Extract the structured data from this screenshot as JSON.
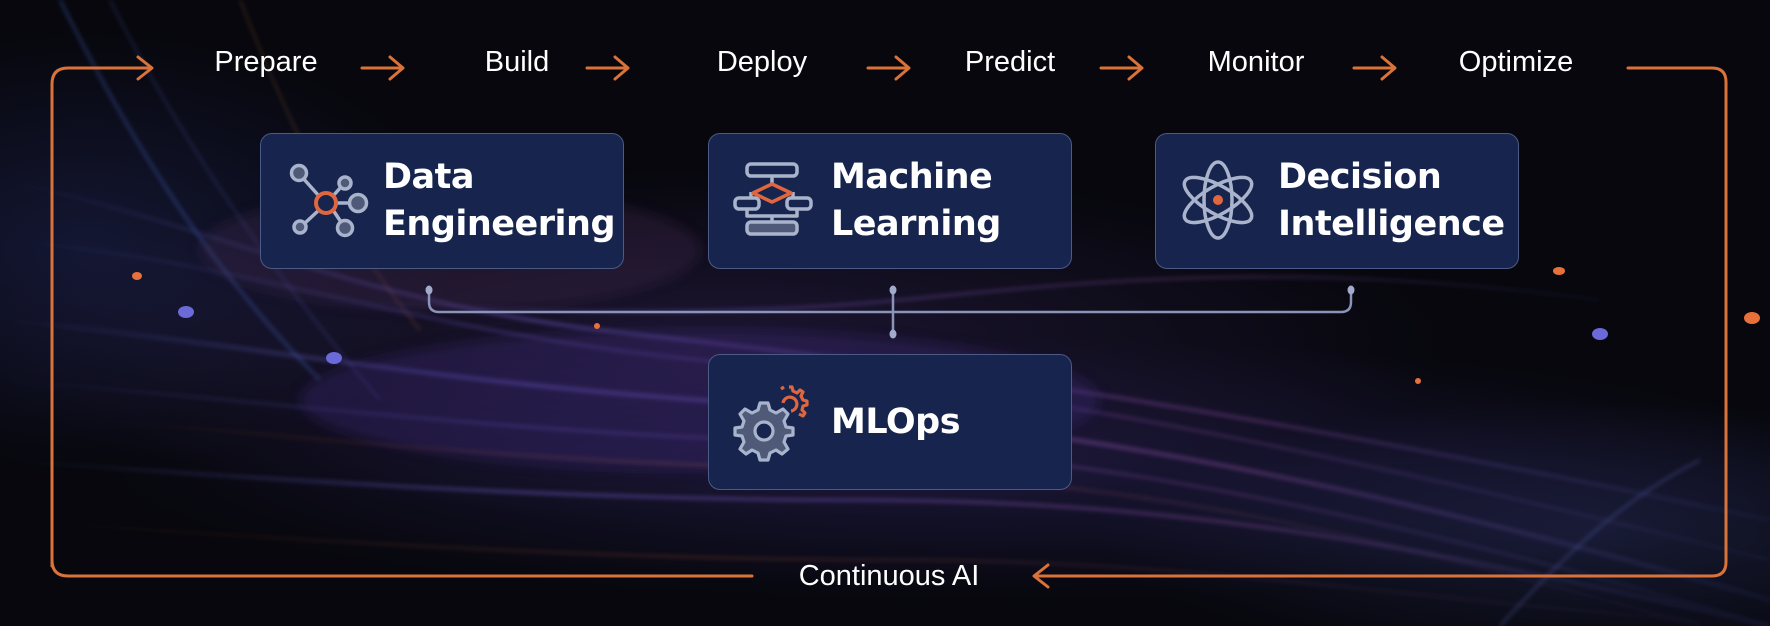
{
  "diagram": {
    "cycle_label": "Continuous AI",
    "steps": [
      "Prepare",
      "Build",
      "Deploy",
      "Predict",
      "Monitor",
      "Optimize"
    ],
    "cards": [
      {
        "label_line1": "Data",
        "label_line2": "Engineering",
        "icon": "network-nodes-icon"
      },
      {
        "label_line1": "Machine",
        "label_line2": "Learning",
        "icon": "flowchart-icon"
      },
      {
        "label_line1": "Decision",
        "label_line2": "Intelligence",
        "icon": "atom-icon"
      },
      {
        "label_line1": "MLOps",
        "label_line2": "",
        "icon": "gears-icon"
      }
    ],
    "connections": [
      [
        "Data Engineering",
        "MLOps"
      ],
      [
        "Machine Learning",
        "MLOps"
      ],
      [
        "Decision Intelligence",
        "MLOps"
      ]
    ]
  },
  "colors": {
    "accent_orange": "#d9733a",
    "card_fill": "#16244e",
    "card_border": "#4b5b85",
    "icon_gray": "#a9b4cc",
    "text": "#ffffff",
    "background": "#07070d"
  }
}
